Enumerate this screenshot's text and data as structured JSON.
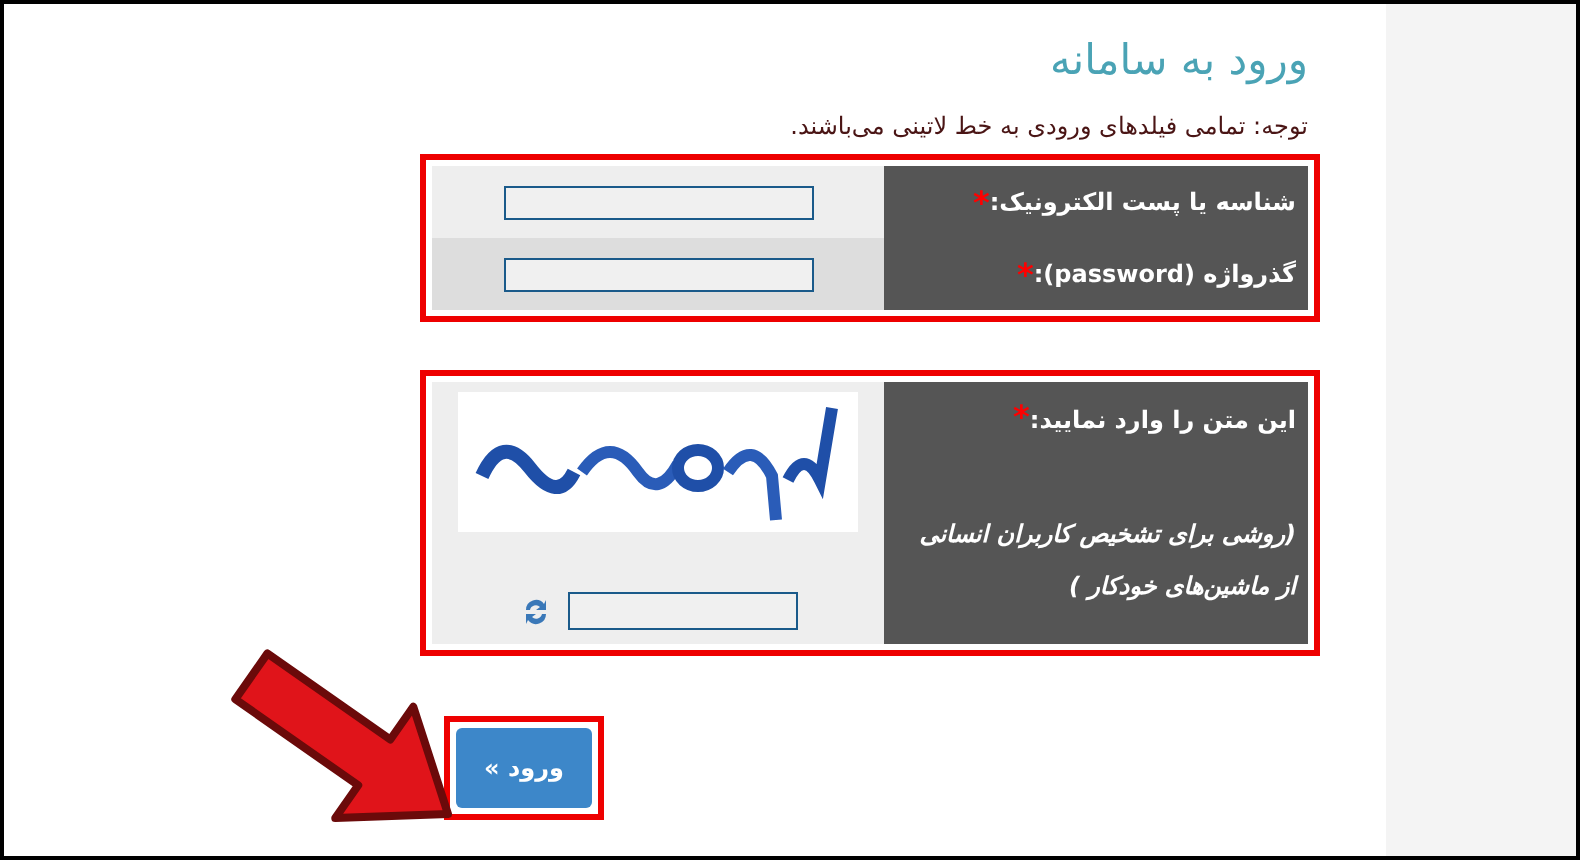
{
  "page": {
    "title": "ورود به سامانه",
    "note": "توجه: تمامی فیلدهای ورودی به خط لاتینی می‌باشند."
  },
  "credentials": [
    {
      "label": "شناسه یا پست الکترونیک:",
      "required_mark": "*"
    },
    {
      "label": "گذرواژه (password):",
      "required_mark": "*"
    }
  ],
  "captcha": {
    "label": "این متن را وارد نمایید:",
    "required_mark": "*",
    "hint": "(روشی برای تشخیص کاربران انسانی از ماشین‌های خودکار )"
  },
  "submit_button": "ورود »"
}
